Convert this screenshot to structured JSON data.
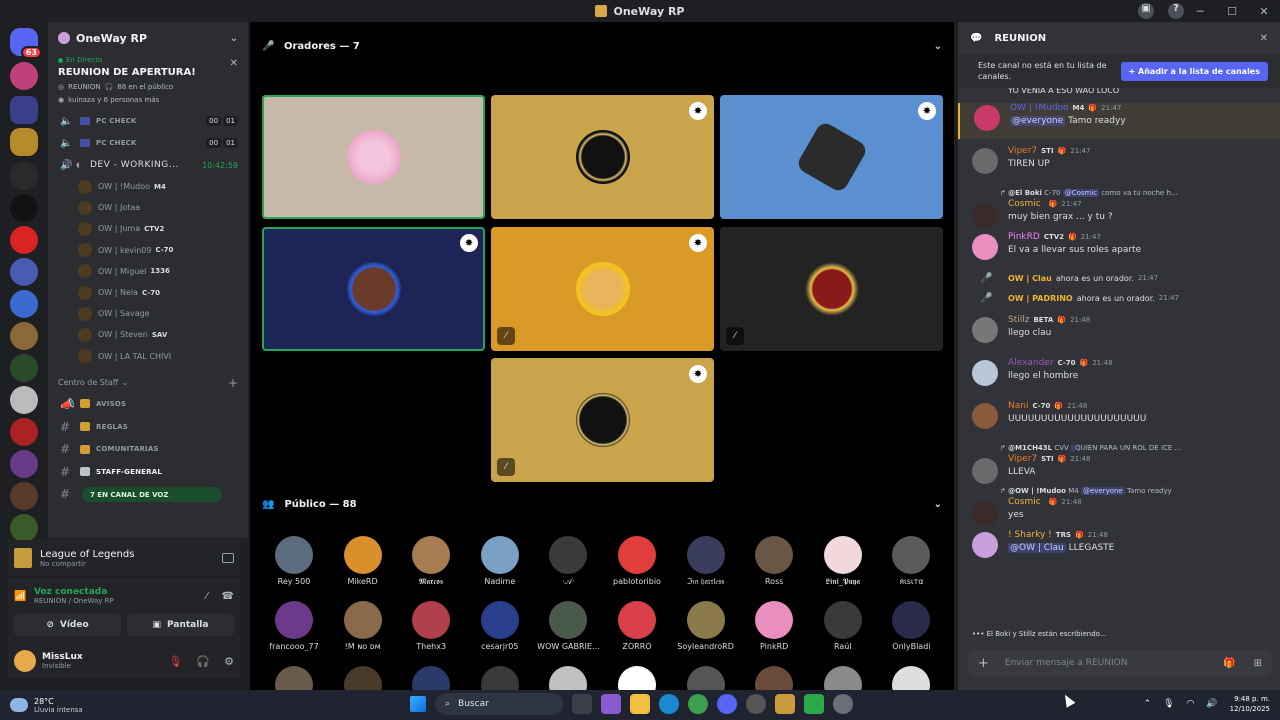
{
  "window": {
    "title": "OneWay RP"
  },
  "server": {
    "name": "OneWay RP"
  },
  "live": {
    "status": "En Directo",
    "title": "REUNION DE APERTURA!",
    "channel": "REUNION",
    "audience": "88 en el público",
    "people": "kuinaza y 6 personas más"
  },
  "voice_channels": [
    {
      "name": "PC CHECK",
      "c1": "00",
      "c2": "01"
    },
    {
      "name": "PC CHECK",
      "c1": "00",
      "c2": "01"
    },
    {
      "name": "DEV - WORKING...",
      "timer": "10:42:59"
    }
  ],
  "voice_members": [
    {
      "name": "OW | !Mudoo",
      "tag": "M4"
    },
    {
      "name": "OW | Jotaa",
      "tag": ""
    },
    {
      "name": "OW | Juma",
      "tag": "CTV2"
    },
    {
      "name": "OW | kevin09",
      "tag": "C-70"
    },
    {
      "name": "OW | Miguel",
      "tag": "1336"
    },
    {
      "name": "OW | Nela",
      "tag": "C-70"
    },
    {
      "name": "OW | Savage",
      "tag": ""
    },
    {
      "name": "OW | Steven",
      "tag": "SAV"
    },
    {
      "name": "OW | LA TAL CHIVI",
      "tag": ""
    }
  ],
  "staff_category": "Centro de Staff",
  "text_channels": [
    {
      "name": "AVISOS"
    },
    {
      "name": "REGLAS"
    },
    {
      "name": "COMUNITARIAS"
    },
    {
      "name": "STAFF-GENERAL"
    }
  ],
  "voice_pill": "7 EN CANAL DE VOZ",
  "game_panel": {
    "title": "League of Legends",
    "sub": "No compartir"
  },
  "voice_panel": {
    "status": "Voz conectada",
    "location": "REUNION",
    "server": "/ OneWay RP",
    "video_label": "Vídeo",
    "screen_label": "Pantalla"
  },
  "user": {
    "name": "MissLux",
    "status": "Invisible"
  },
  "stage": {
    "speakers_label": "Oradores — 7",
    "audience_label": "Público — 88"
  },
  "audience": [
    {
      "name": "Rey 500",
      "color": "#5a6c7e"
    },
    {
      "name": "MikeRD",
      "color": "#d98f2b"
    },
    {
      "name": "𝕸𝖆𝖗𝖈𝖔𝖘",
      "color": "#a67c52"
    },
    {
      "name": "Nadime",
      "color": "#7aa0c4"
    },
    {
      "name": "·𝒜·",
      "color": "#3b3b3b"
    },
    {
      "name": "pablotoribio",
      "color": "#e23d3d"
    },
    {
      "name": "ℑ𝔪 𝔥𝔞𝔯𝔱𝔩𝔢𝔰𝔰",
      "color": "#3b3d5e"
    },
    {
      "name": "Ross",
      "color": "#6a5644"
    },
    {
      "name": "𝕷𝖎𝖓𝖎_𝕻𝖚𝖞𝖆",
      "color": "#f0d8dc"
    },
    {
      "name": "яιѕιтα",
      "color": "#5a5a5a"
    },
    {
      "name": "francooo_77",
      "color": "#6c3a8a"
    },
    {
      "name": "!M ɴᴏ ᴅᴍ",
      "color": "#8a6a4a"
    },
    {
      "name": "Thehx3",
      "color": "#b0404a"
    },
    {
      "name": "cesarjr05",
      "color": "#2a3f8c"
    },
    {
      "name": "WOW GABRIE...",
      "color": "#4a5a4a"
    },
    {
      "name": "ZORRO",
      "color": "#d9414a"
    },
    {
      "name": "SoyleandroRD",
      "color": "#8a7a4a"
    },
    {
      "name": "PinkRD",
      "color": "#e88fc0"
    },
    {
      "name": "Raúl",
      "color": "#3a3a3a"
    },
    {
      "name": "OnlyBladi",
      "color": "#2a2a4a"
    }
  ],
  "chat": {
    "channel": "REUNION",
    "notice": "Este canal no está en tu lista de canales.",
    "add_button": "Añadir a la lista de canales",
    "clipped_line": "YO VENIA A ESO WAO LOCO",
    "messages": [
      {
        "author": "OW | !Mudoo",
        "tag": "M4",
        "time": "21:47",
        "mention": "@everyone",
        "text": "Tamo readyy",
        "color": "#5865f2",
        "ava": "#c93a6a",
        "hl": true
      },
      {
        "author": "Viper7",
        "tag": "STI",
        "time": "21:47",
        "text": "TIREN UP",
        "color": "#e67e22",
        "ava": "#6a6a6a"
      },
      {
        "reply_author": "@El Boki",
        "reply_tag": "C-70",
        "reply_mention": "@Cosmic",
        "reply_text": "como va tu noche h...",
        "author": "Cosmic",
        "tag": "",
        "time": "21:47",
        "text": "muy bien grax ... y tu ?",
        "color": "#f0b232",
        "ava": "#3a2a2a"
      },
      {
        "author": "PinkRD",
        "tag": "CTV2",
        "time": "21:47",
        "text": "El va a llevar sus roles aparte",
        "color": "#f47fff",
        "ava": "#e88fc0"
      },
      {
        "author": "Stillz",
        "tag": "BETA",
        "time": "21:48",
        "text": "llego clau",
        "color": "#c9a27a",
        "ava": "#777"
      },
      {
        "author": "Alexander",
        "tag": "C-70",
        "time": "21:48",
        "text": "llego el hombre",
        "color": "#9b59b6",
        "ava": "#b8c6d6"
      },
      {
        "author": "Nani",
        "tag": "C-70",
        "time": "21:48",
        "text": "UUUUUUUUUUUUUUUUUUUUU",
        "color": "#e67e22",
        "ava": "#8a5a3a"
      },
      {
        "reply_author": "@M1CH43L",
        "reply_tag": "CVV",
        "reply_mention": "",
        "reply_text": "QUIEN PARA UN ROL DE ICE ...",
        "author": "Viper7",
        "tag": "STI",
        "time": "21:48",
        "text": "LLEVA",
        "color": "#e67e22",
        "ava": "#6a6a6a"
      },
      {
        "reply_author": "@OW | !Mudoo",
        "reply_tag": "M4",
        "reply_mention": "@everyone",
        "reply_text": "Tamo readyy",
        "author": "Cosmic",
        "tag": "",
        "time": "21:48",
        "text": "yes",
        "color": "#f0b232",
        "ava": "#3a2a2a"
      },
      {
        "author": "! Sharky !",
        "tag": "TRS",
        "time": "21:48",
        "mention": "@OW | Clau",
        "text": "LLEGASTE",
        "color": "#f0b232",
        "ava": "#c9a0dc"
      }
    ],
    "system": [
      {
        "name": "OW | Clau",
        "text": "ahora es un orador.",
        "time": "21:47"
      },
      {
        "name": "OW | PADRINO",
        "text": "ahora es un orador.",
        "time": "21:47"
      }
    ],
    "typing": "El Boki y Stillz están escribiendo...",
    "input_placeholder": "Enviar mensaje a",
    "input_target": "REUNION"
  },
  "taskbar": {
    "temp": "28°C",
    "weather": "Lluvia intensa",
    "search": "Buscar",
    "time": "9:48 p. m.",
    "date": "12/10/2025"
  }
}
